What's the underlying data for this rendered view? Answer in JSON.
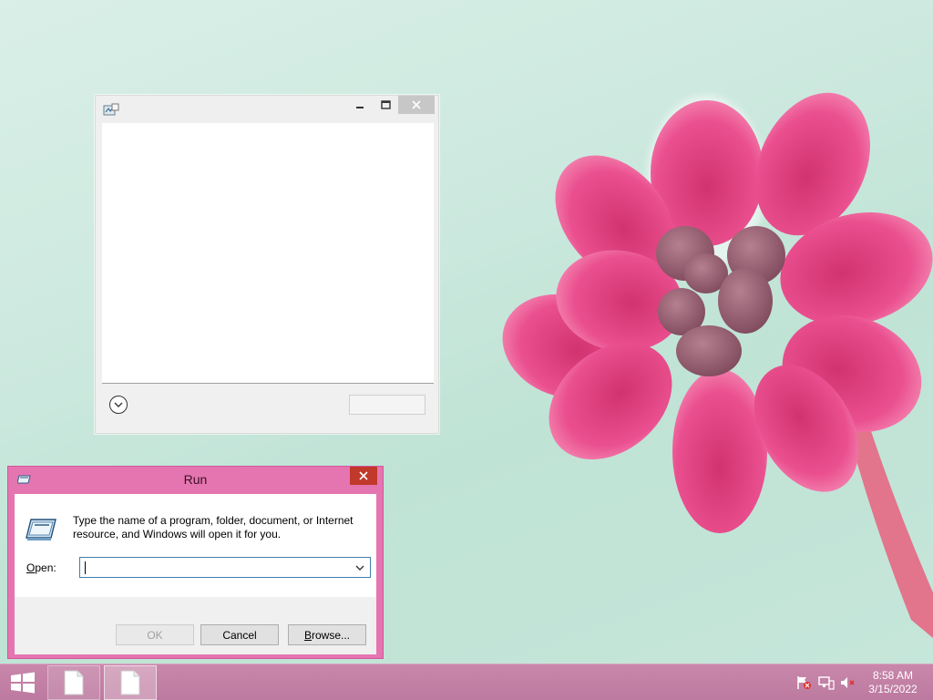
{
  "desktop": {
    "wallpaper_icon": "pink-flower"
  },
  "blank_window": {
    "title": "",
    "icon": "app-icon",
    "controls": [
      "minimize-icon",
      "maximize-icon",
      "close-icon"
    ]
  },
  "run_dialog": {
    "title": "Run",
    "description": "Type the name of a program, folder, document, or Internet resource, and Windows will open it for you.",
    "open_label_prefix": "O",
    "open_label_rest": "pen:",
    "open_value": "",
    "ok_label": "OK",
    "cancel_label": "Cancel",
    "browse_label_prefix": "B",
    "browse_label_rest": "rowse...",
    "accent_color": "#e575b0"
  },
  "taskbar": {
    "color": "#c282a6",
    "start_icon": "windows-logo-icon",
    "buttons": [
      "document-icon",
      "document-icon"
    ],
    "tray": [
      "flag-icon",
      "network-icon",
      "volume-icon"
    ],
    "time": "8:58 AM",
    "date": "3/15/2022"
  }
}
